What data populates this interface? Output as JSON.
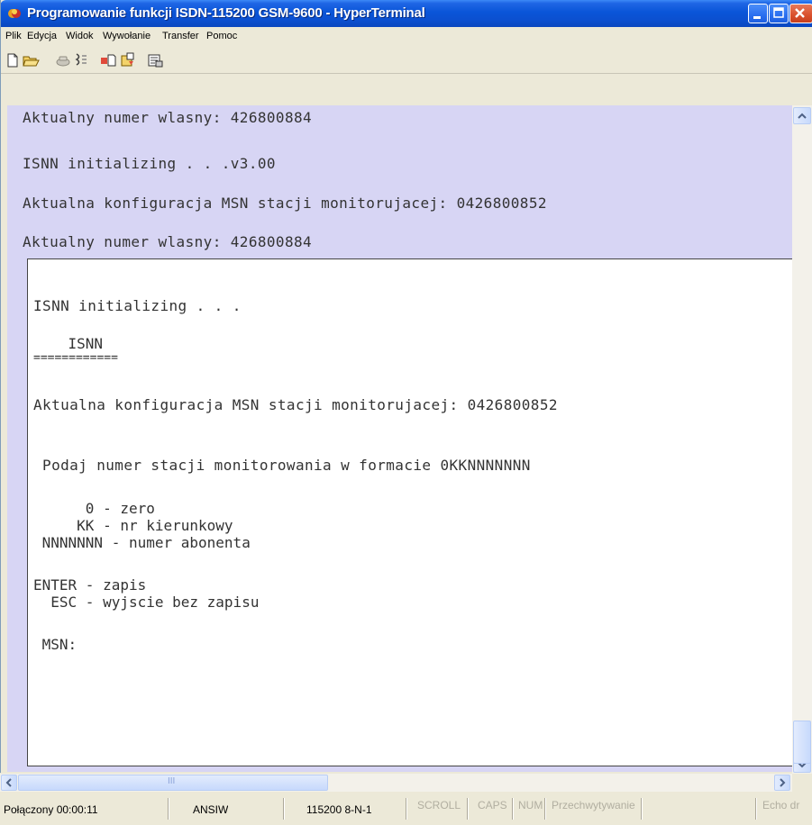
{
  "window": {
    "title": "Programowanie funkcji ISDN-115200 GSM-9600 - HyperTerminal",
    "app_icon": "hyperterminal-icon",
    "title_color": "#0a55d8",
    "close_color": "#d9502c"
  },
  "menu": [
    "Plik",
    "Edycja",
    "Widok",
    "Wywołanie",
    "Transfer",
    "Pomoc"
  ],
  "toolbar": {
    "icons": [
      "new-icon",
      "open-icon",
      "phone-icon",
      "disconnect-icon",
      "send-icon",
      "receive-icon",
      "properties-icon"
    ]
  },
  "terminal": {
    "background": "#d7d5f4",
    "upper_lines": [
      "Aktualny numer wlasny: 426800884",
      "ISNN initializing . . .v3.00",
      "Aktualna konfiguracja MSN stacji monitorujacej: 0426800852",
      "Aktualny numer wlasny: 426800884"
    ],
    "overlay_lines": [
      "ISNN initializing . . .",
      "    ISNN",
      "============",
      "Aktualna konfiguracja MSN stacji monitorujacej: 0426800852",
      " Podaj numer stacji monitorowania w formacie 0KKNNNNNNN",
      "      0 - zero",
      "     KK - nr kierunkowy",
      " NNNNNNN - numer abonenta",
      "ENTER - zapis",
      "  ESC - wyjscie bez zapisu",
      " MSN:"
    ]
  },
  "hscroll_grip": "III",
  "status": {
    "connected": "Połączony 00:00:11",
    "emulation": "ANSIW",
    "port": "115200 8-N-1",
    "scroll": "SCROLL",
    "caps": "CAPS",
    "num": "NUM",
    "capture": "Przechwytywanie",
    "echo": "Echo dr"
  }
}
